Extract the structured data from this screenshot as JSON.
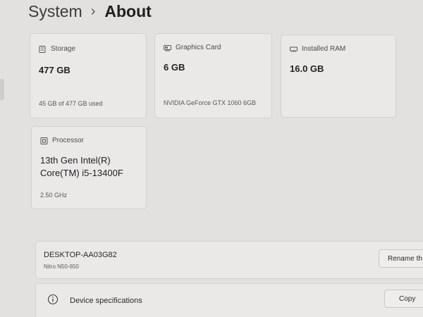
{
  "breadcrumb": {
    "parent": "System",
    "separator": "›",
    "current": "About"
  },
  "cards": {
    "storage": {
      "icon": "storage-icon",
      "title": "Storage",
      "value": "477 GB",
      "sub": "45 GB of 477 GB used"
    },
    "graphics": {
      "icon": "graphics-card-icon",
      "title": "Graphics Card",
      "value": "6 GB",
      "sub": "NVIDIA GeForce GTX 1060 6GB"
    },
    "ram": {
      "icon": "ram-icon",
      "title": "Installed RAM",
      "value": "16.0 GB",
      "sub": ""
    },
    "processor": {
      "icon": "processor-icon",
      "title": "Processor",
      "value_line1": "13th Gen Intel(R)",
      "value_line2": "Core(TM) i5-13400F",
      "sub": "2.50 GHz"
    }
  },
  "device": {
    "name": "DESKTOP-AA03G82",
    "model": "Nitro N50-650",
    "rename_label": "Rename th"
  },
  "specs": {
    "icon": "info-icon",
    "title": "Device specifications",
    "copy_label": "Copy"
  }
}
